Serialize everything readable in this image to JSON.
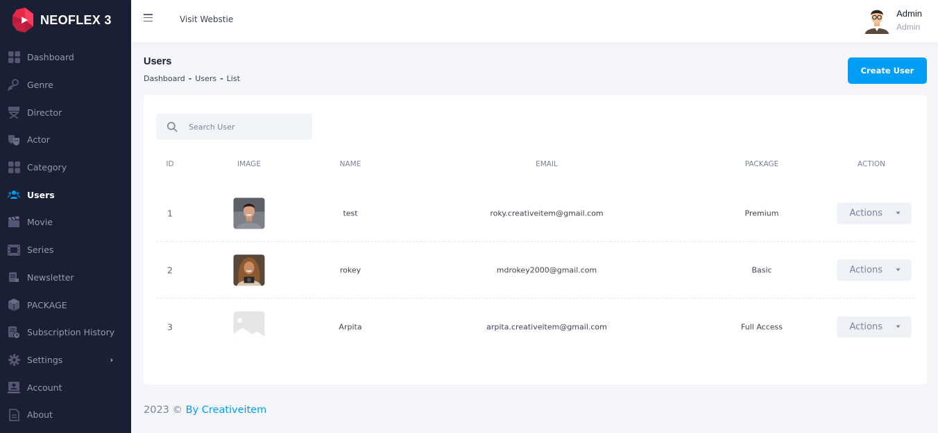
{
  "brand": {
    "name": "NEOFLEX 3",
    "logo_color": "#e6294b"
  },
  "sidebar": {
    "items": [
      {
        "label": "Dashboard",
        "icon": "dashboard-grid-icon"
      },
      {
        "label": "Genre",
        "icon": "genre-user-icon"
      },
      {
        "label": "Director",
        "icon": "director-chair-icon"
      },
      {
        "label": "Actor",
        "icon": "theater-masks-icon"
      },
      {
        "label": "Category",
        "icon": "category-grid-icon"
      },
      {
        "label": "Users",
        "icon": "users-icon",
        "active": true
      },
      {
        "label": "Movie",
        "icon": "clapperboard-icon"
      },
      {
        "label": "Series",
        "icon": "series-film-icon"
      },
      {
        "label": "Newsletter",
        "icon": "newsletter-icon"
      },
      {
        "label": "PACKAGE",
        "icon": "package-box-icon"
      },
      {
        "label": "Subscription History",
        "icon": "subscription-history-icon"
      },
      {
        "label": "Settings",
        "icon": "settings-gear-icon"
      },
      {
        "label": "Account",
        "icon": "account-icon"
      },
      {
        "label": "About",
        "icon": "about-document-icon"
      }
    ]
  },
  "header": {
    "visit_label": "Visit Webstie",
    "user_name": "Admin",
    "user_role": "Admin"
  },
  "page": {
    "title": "Users",
    "breadcrumb": [
      "Dashboard",
      "Users",
      "List"
    ],
    "create_label": "Create User"
  },
  "search": {
    "placeholder": "Search User"
  },
  "table": {
    "columns": [
      "ID",
      "IMAGE",
      "NAME",
      "EMAIL",
      "PACKAGE",
      "ACTION"
    ],
    "rows": [
      {
        "id": "1",
        "name": "test",
        "email": "roky.creativeitem@gmail.com",
        "package": "Premium",
        "action": "Actions"
      },
      {
        "id": "2",
        "name": "rokey",
        "email": "mdrokey2000@gmail.com",
        "package": "Basic",
        "action": "Actions"
      },
      {
        "id": "3",
        "name": "Arpita",
        "email": "arpita.creativeitem@gmail.com",
        "package": "Full Access",
        "action": "Actions"
      }
    ]
  },
  "footer": {
    "year": "2023 ©",
    "link": "By Creativeitem"
  },
  "colors": {
    "primary": "#009ef7",
    "sidebar_bg": "#1b1f33",
    "active_icon": "#009ef7"
  }
}
